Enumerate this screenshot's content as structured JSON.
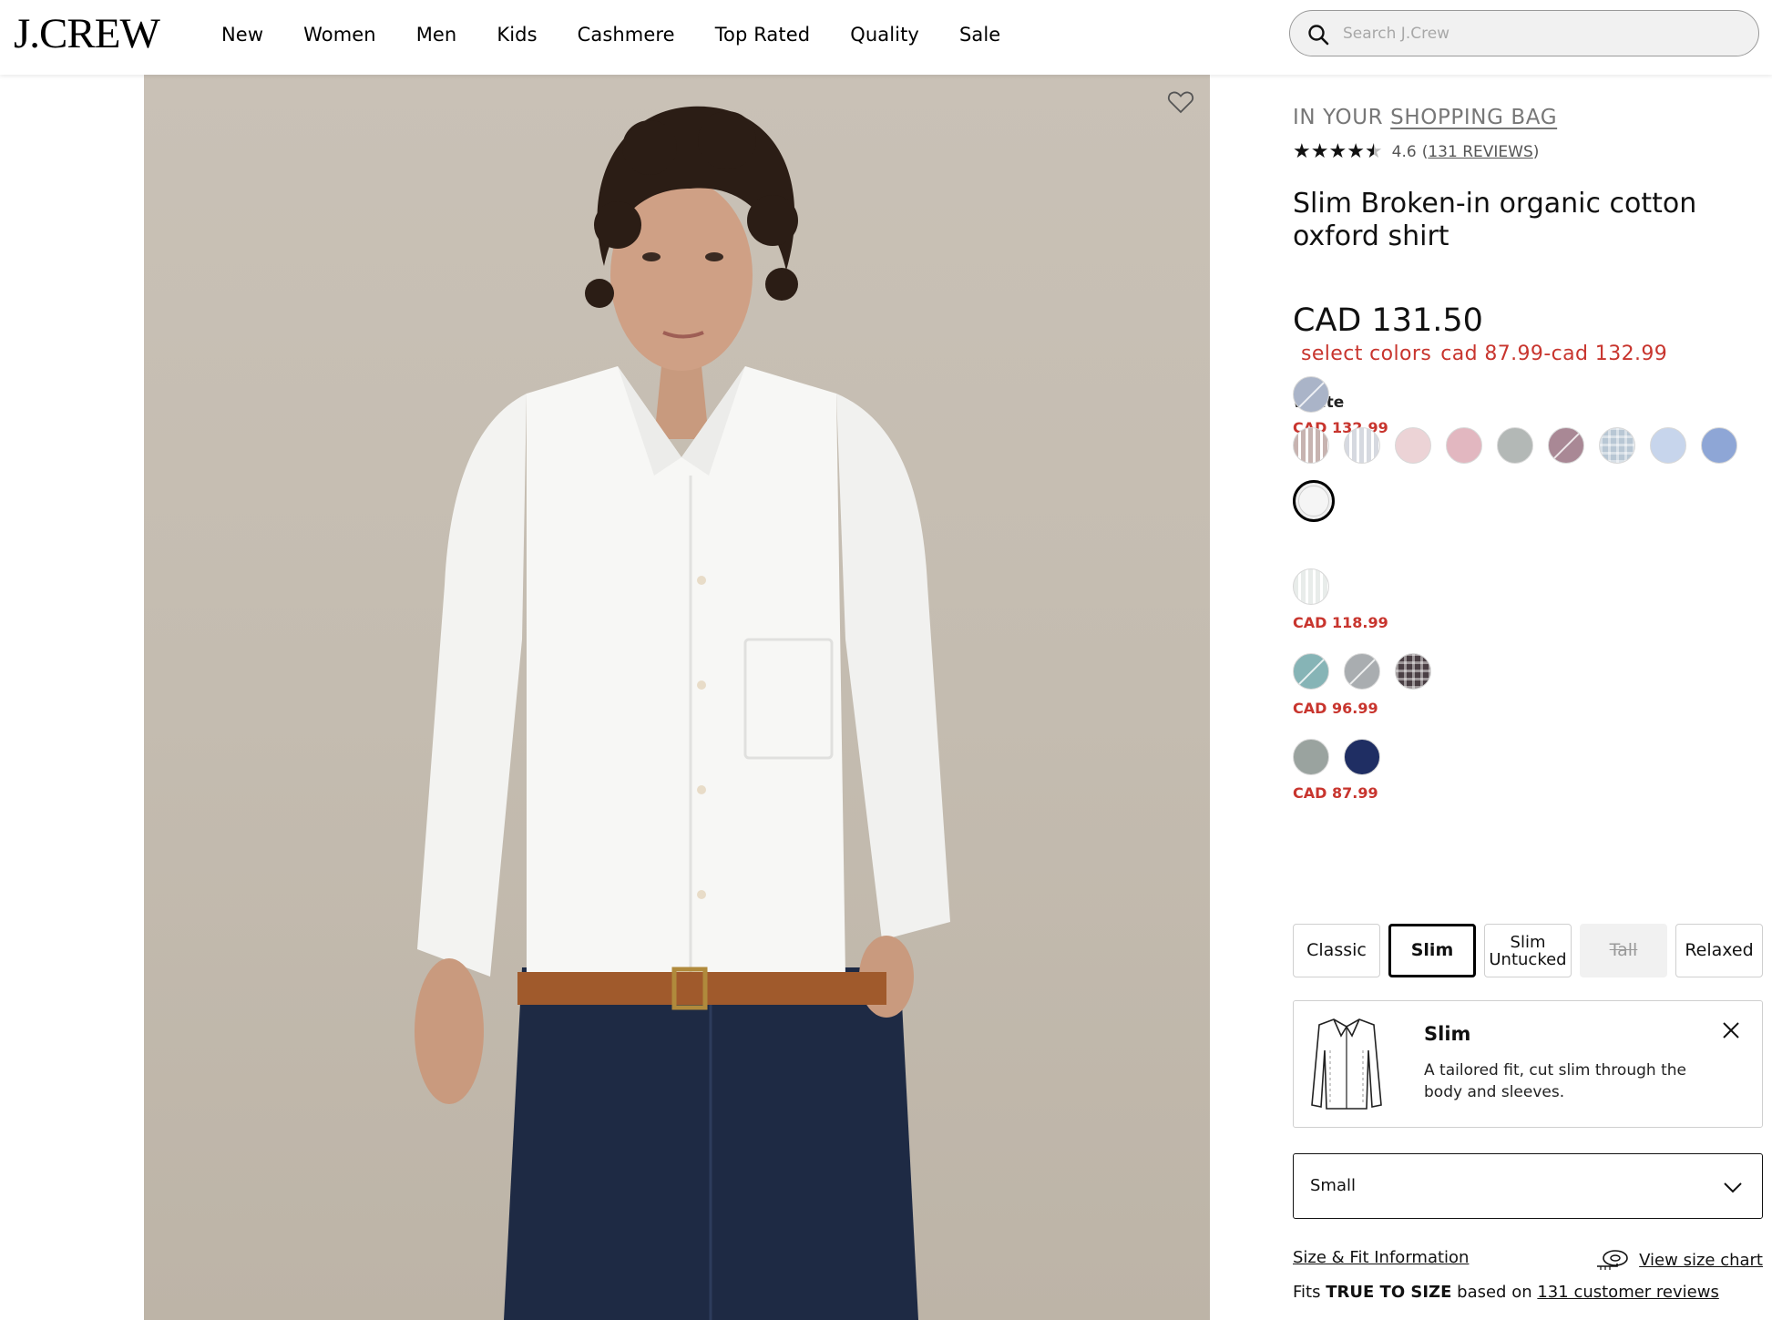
{
  "brand": {
    "logo": "J.CREW"
  },
  "nav": {
    "items": [
      "New",
      "Women",
      "Men",
      "Kids",
      "Cashmere",
      "Top Rated",
      "Quality",
      "Sale"
    ]
  },
  "search": {
    "placeholder": "Search J.Crew",
    "icon": "search-icon"
  },
  "product": {
    "bag_prefix": "IN YOUR",
    "bag_link": "SHOPPING BAG",
    "rating_value": "4.6",
    "rating_stars": 4.5,
    "reviews_label": "131 REVIEWS",
    "title": "Slim Broken-in organic cotton oxford shirt",
    "price": "CAD 131.50",
    "sale_prefix": "select colors",
    "sale_range": "cad 87.99-cad 132.99",
    "selected_color": "White",
    "favorite_icon": "heart-icon"
  },
  "color_groups": [
    {
      "price": "CAD 132.99",
      "swatches": [
        {
          "color": "#aab4c8",
          "slash": true
        },
        {
          "color": "#c7b3b0",
          "pattern": "stripe"
        },
        {
          "color": "#d6d9e0",
          "pattern": "stripe"
        },
        {
          "color": "#ecd3d6"
        },
        {
          "color": "#e2b7c0"
        },
        {
          "color": "#b3b8b6"
        },
        {
          "color": "#a98895",
          "slash": true
        },
        {
          "color": "#b8c7d4",
          "pattern": "plaid"
        },
        {
          "color": "#c7d5ec"
        },
        {
          "color": "#8ea6d6"
        },
        {
          "color": "#f2f2f2",
          "selected": true
        }
      ]
    },
    {
      "price": "CAD 118.99",
      "swatches": [
        {
          "color": "#e8ecea",
          "pattern": "stripe"
        }
      ]
    },
    {
      "price": "CAD 96.99",
      "swatches": [
        {
          "color": "#86b4b6",
          "slash": true
        },
        {
          "color": "#a9adb0",
          "slash": true
        },
        {
          "color": "#4a3f44",
          "pattern": "plaid"
        }
      ]
    },
    {
      "price": "CAD 87.99",
      "swatches": [
        {
          "color": "#9aa39f"
        },
        {
          "color": "#1f2e63"
        }
      ]
    }
  ],
  "fits": [
    {
      "label": "Classic",
      "state": "normal"
    },
    {
      "label": "Slim",
      "state": "active"
    },
    {
      "label": "Slim Untucked",
      "state": "normal"
    },
    {
      "label": "Tall",
      "state": "disabled"
    },
    {
      "label": "Relaxed",
      "state": "normal"
    }
  ],
  "fit_card": {
    "name": "Slim",
    "description": "A tailored fit, cut slim through the body and sleeves.",
    "icon": "shirt-icon",
    "close_icon": "close-icon"
  },
  "size_select": {
    "value": "Small",
    "icon": "chevron-down-icon"
  },
  "size_links": {
    "fit_info": "Size & Fit Information",
    "size_chart": "View size chart",
    "size_chart_icon": "measuring-tape-icon"
  },
  "true_to_size": {
    "prefix": "Fits",
    "bold": "TRUE TO SIZE",
    "middle": "based on",
    "link": "131 customer reviews"
  },
  "colors": {
    "sale_red": "#c8352e",
    "text": "#111111",
    "muted": "#777777"
  }
}
